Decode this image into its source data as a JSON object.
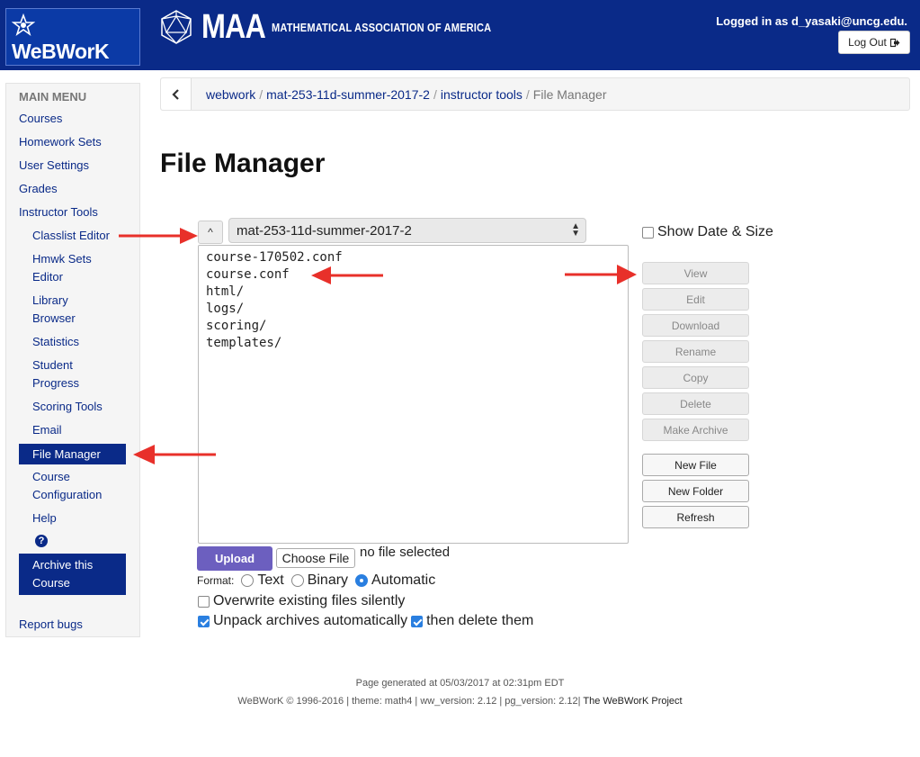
{
  "header": {
    "app_name": "WeBWorK",
    "maa_big": "MAA",
    "maa_small": "MATHEMATICAL ASSOCIATION OF AMERICA",
    "login_text": "Logged in as d_yasaki@uncg.edu.",
    "logout_label": "Log Out",
    "colors": {
      "bar": "#0a2a88",
      "logo_bg": "#0b3aa6"
    }
  },
  "sidebar": {
    "title": "MAIN MENU",
    "items": [
      {
        "label": "Courses"
      },
      {
        "label": "Homework Sets"
      },
      {
        "label": "User Settings"
      },
      {
        "label": "Grades"
      },
      {
        "label": "Instructor Tools"
      },
      {
        "label": "Classlist Editor"
      },
      {
        "label": "Hmwk Sets"
      },
      {
        "label": "Editor"
      },
      {
        "label": "Library"
      },
      {
        "label": "Browser"
      },
      {
        "label": "Statistics"
      },
      {
        "label": "Student"
      },
      {
        "label": "Progress"
      },
      {
        "label": "Scoring Tools"
      },
      {
        "label": "Email"
      },
      {
        "label": "File Manager"
      },
      {
        "label": "Course"
      },
      {
        "label": "Configuration"
      },
      {
        "label": "Help"
      },
      {
        "label": "Archive this"
      },
      {
        "label": "Course"
      },
      {
        "label": "Report bugs"
      }
    ],
    "active_item": "File Manager"
  },
  "breadcrumb": {
    "items": [
      {
        "label": "webwork"
      },
      {
        "label": "mat-253-11d-summer-2017-2"
      },
      {
        "label": "instructor tools"
      },
      {
        "label": "File Manager"
      }
    ],
    "separator": "/"
  },
  "page": {
    "title": "File Manager"
  },
  "file_manager": {
    "up_label": "^",
    "current_dir": "mat-253-11d-summer-2017-2",
    "files": [
      "course-170502.conf",
      "course.conf",
      "html/",
      "logs/",
      "scoring/",
      "templates/"
    ],
    "show_date_size_label": "Show Date & Size",
    "show_date_size_checked": false,
    "actions": [
      {
        "label": "View",
        "enabled": false
      },
      {
        "label": "Edit",
        "enabled": false
      },
      {
        "label": "Download",
        "enabled": false
      },
      {
        "label": "Rename",
        "enabled": false
      },
      {
        "label": "Copy",
        "enabled": false
      },
      {
        "label": "Delete",
        "enabled": false
      },
      {
        "label": "Make Archive",
        "enabled": false
      },
      {
        "label": "New File",
        "enabled": true
      },
      {
        "label": "New Folder",
        "enabled": true
      },
      {
        "label": "Refresh",
        "enabled": true
      }
    ]
  },
  "upload": {
    "upload_label": "Upload",
    "choose_label": "Choose File",
    "no_file_text": "no file selected",
    "format_label": "Format:",
    "formats": [
      {
        "label": "Text",
        "checked": false
      },
      {
        "label": "Binary",
        "checked": false
      },
      {
        "label": "Automatic",
        "checked": true
      }
    ],
    "overwrite_label": "Overwrite existing files silently",
    "overwrite_checked": false,
    "unpack_label": "Unpack archives automatically",
    "unpack_checked": true,
    "delete_label": "then delete them",
    "delete_checked": true
  },
  "footer": {
    "generated": "Page generated at 05/03/2017 at 02:31pm EDT",
    "copyright": "WeBWorK © 1996-2016 | theme: math4 | ww_version: 2.12 | pg_version: 2.12|",
    "project_link": "The WeBWorK Project"
  },
  "annotations": {
    "arrow_color": "#e8302a"
  }
}
